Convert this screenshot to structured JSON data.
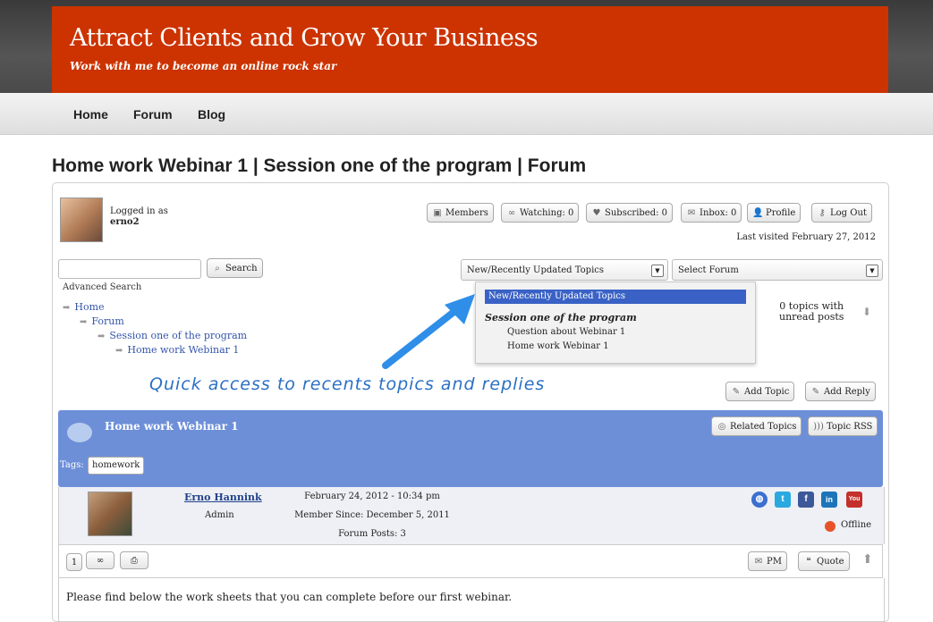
{
  "site": {
    "title": "Attract Clients and Grow Your Business",
    "tagline": "Work with me to become an online rock star"
  },
  "nav": [
    "Home",
    "Forum",
    "Blog"
  ],
  "page_title": "Home work Webinar 1 | Session one of the program | Forum",
  "user": {
    "logged_in_label": "Logged in as",
    "username": "erno2",
    "last_visited": "Last visited February 27, 2012"
  },
  "toolbar": {
    "members": "Members",
    "watching": "Watching: 0",
    "subscribed": "Subscribed: 0",
    "inbox": "Inbox: 0",
    "profile": "Profile",
    "logout": "Log Out"
  },
  "search": {
    "button": "Search",
    "advanced": "Advanced Search",
    "placeholder": ""
  },
  "selects": {
    "topics": "New/Recently Updated Topics",
    "forum": "Select Forum"
  },
  "dropdown": {
    "selected": "New/Recently Updated Topics",
    "group": "Session one of the program",
    "options": [
      "Question about Webinar 1",
      "Home work Webinar 1"
    ]
  },
  "breadcrumbs": [
    "Home",
    "Forum",
    "Session one of the program",
    "Home work Webinar 1"
  ],
  "unread": {
    "line1": "0 topics with",
    "line2": "unread posts"
  },
  "annotation": "Quick access to recents topics and replies",
  "actions": {
    "add_topic": "Add Topic",
    "add_reply": "Add Reply",
    "related": "Related Topics",
    "rss": "Topic RSS"
  },
  "topic": {
    "title": "Home work Webinar 1",
    "tags_label": "Tags:",
    "tag": "homework"
  },
  "post": {
    "author": "Erno Hannink",
    "role": "Admin",
    "date": "February 24, 2012 - 10:34 pm",
    "member_since": "Member Since: December 5, 2011",
    "posts": "Forum Posts: 3",
    "status": "Offline",
    "number": "1",
    "pm": "PM",
    "quote": "Quote",
    "body": "Please find below the work sheets that you can complete before our first webinar."
  },
  "colors": {
    "header": "#cc3300",
    "topic_bar": "#6d8fd8",
    "dropdown_selected": "#3a62c6",
    "annotation": "#2a6fc5"
  }
}
